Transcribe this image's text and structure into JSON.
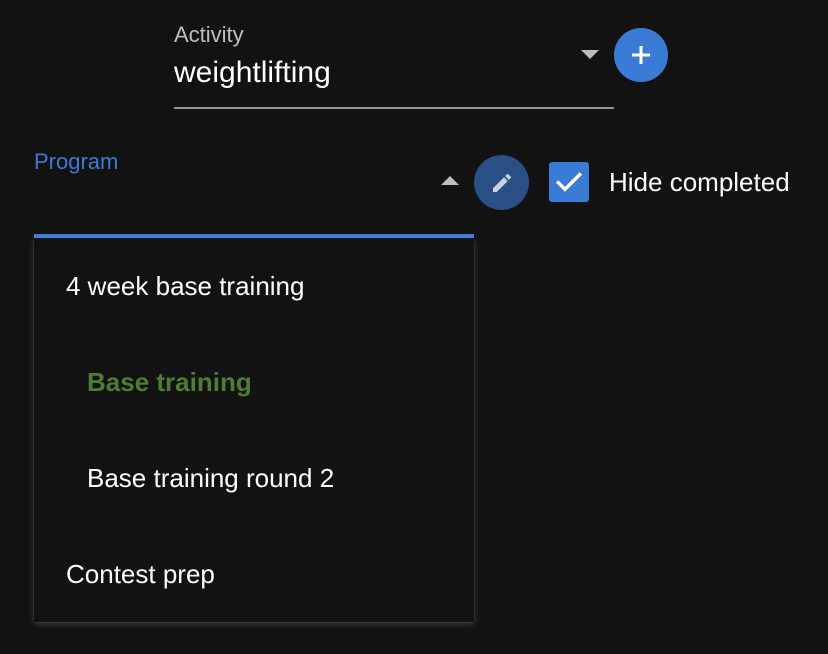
{
  "activity": {
    "label": "Activity",
    "value": "weightlifting"
  },
  "add_button": {
    "icon": "plus-icon"
  },
  "program": {
    "label": "Program"
  },
  "edit_button": {
    "icon": "pencil-icon"
  },
  "hide_completed": {
    "label": "Hide completed",
    "checked": true
  },
  "program_menu": {
    "items": [
      {
        "label": "4 week base training",
        "kind": "group",
        "selected": false
      },
      {
        "label": "Base training",
        "kind": "child",
        "selected": true
      },
      {
        "label": "Base training round 2",
        "kind": "child",
        "selected": false
      },
      {
        "label": "Contest prep",
        "kind": "group",
        "selected": false
      }
    ]
  },
  "colors": {
    "background": "#121212",
    "accent": "#3a7bd5",
    "edit_button": "#2a4f84",
    "selected_item": "#4e7d31"
  }
}
